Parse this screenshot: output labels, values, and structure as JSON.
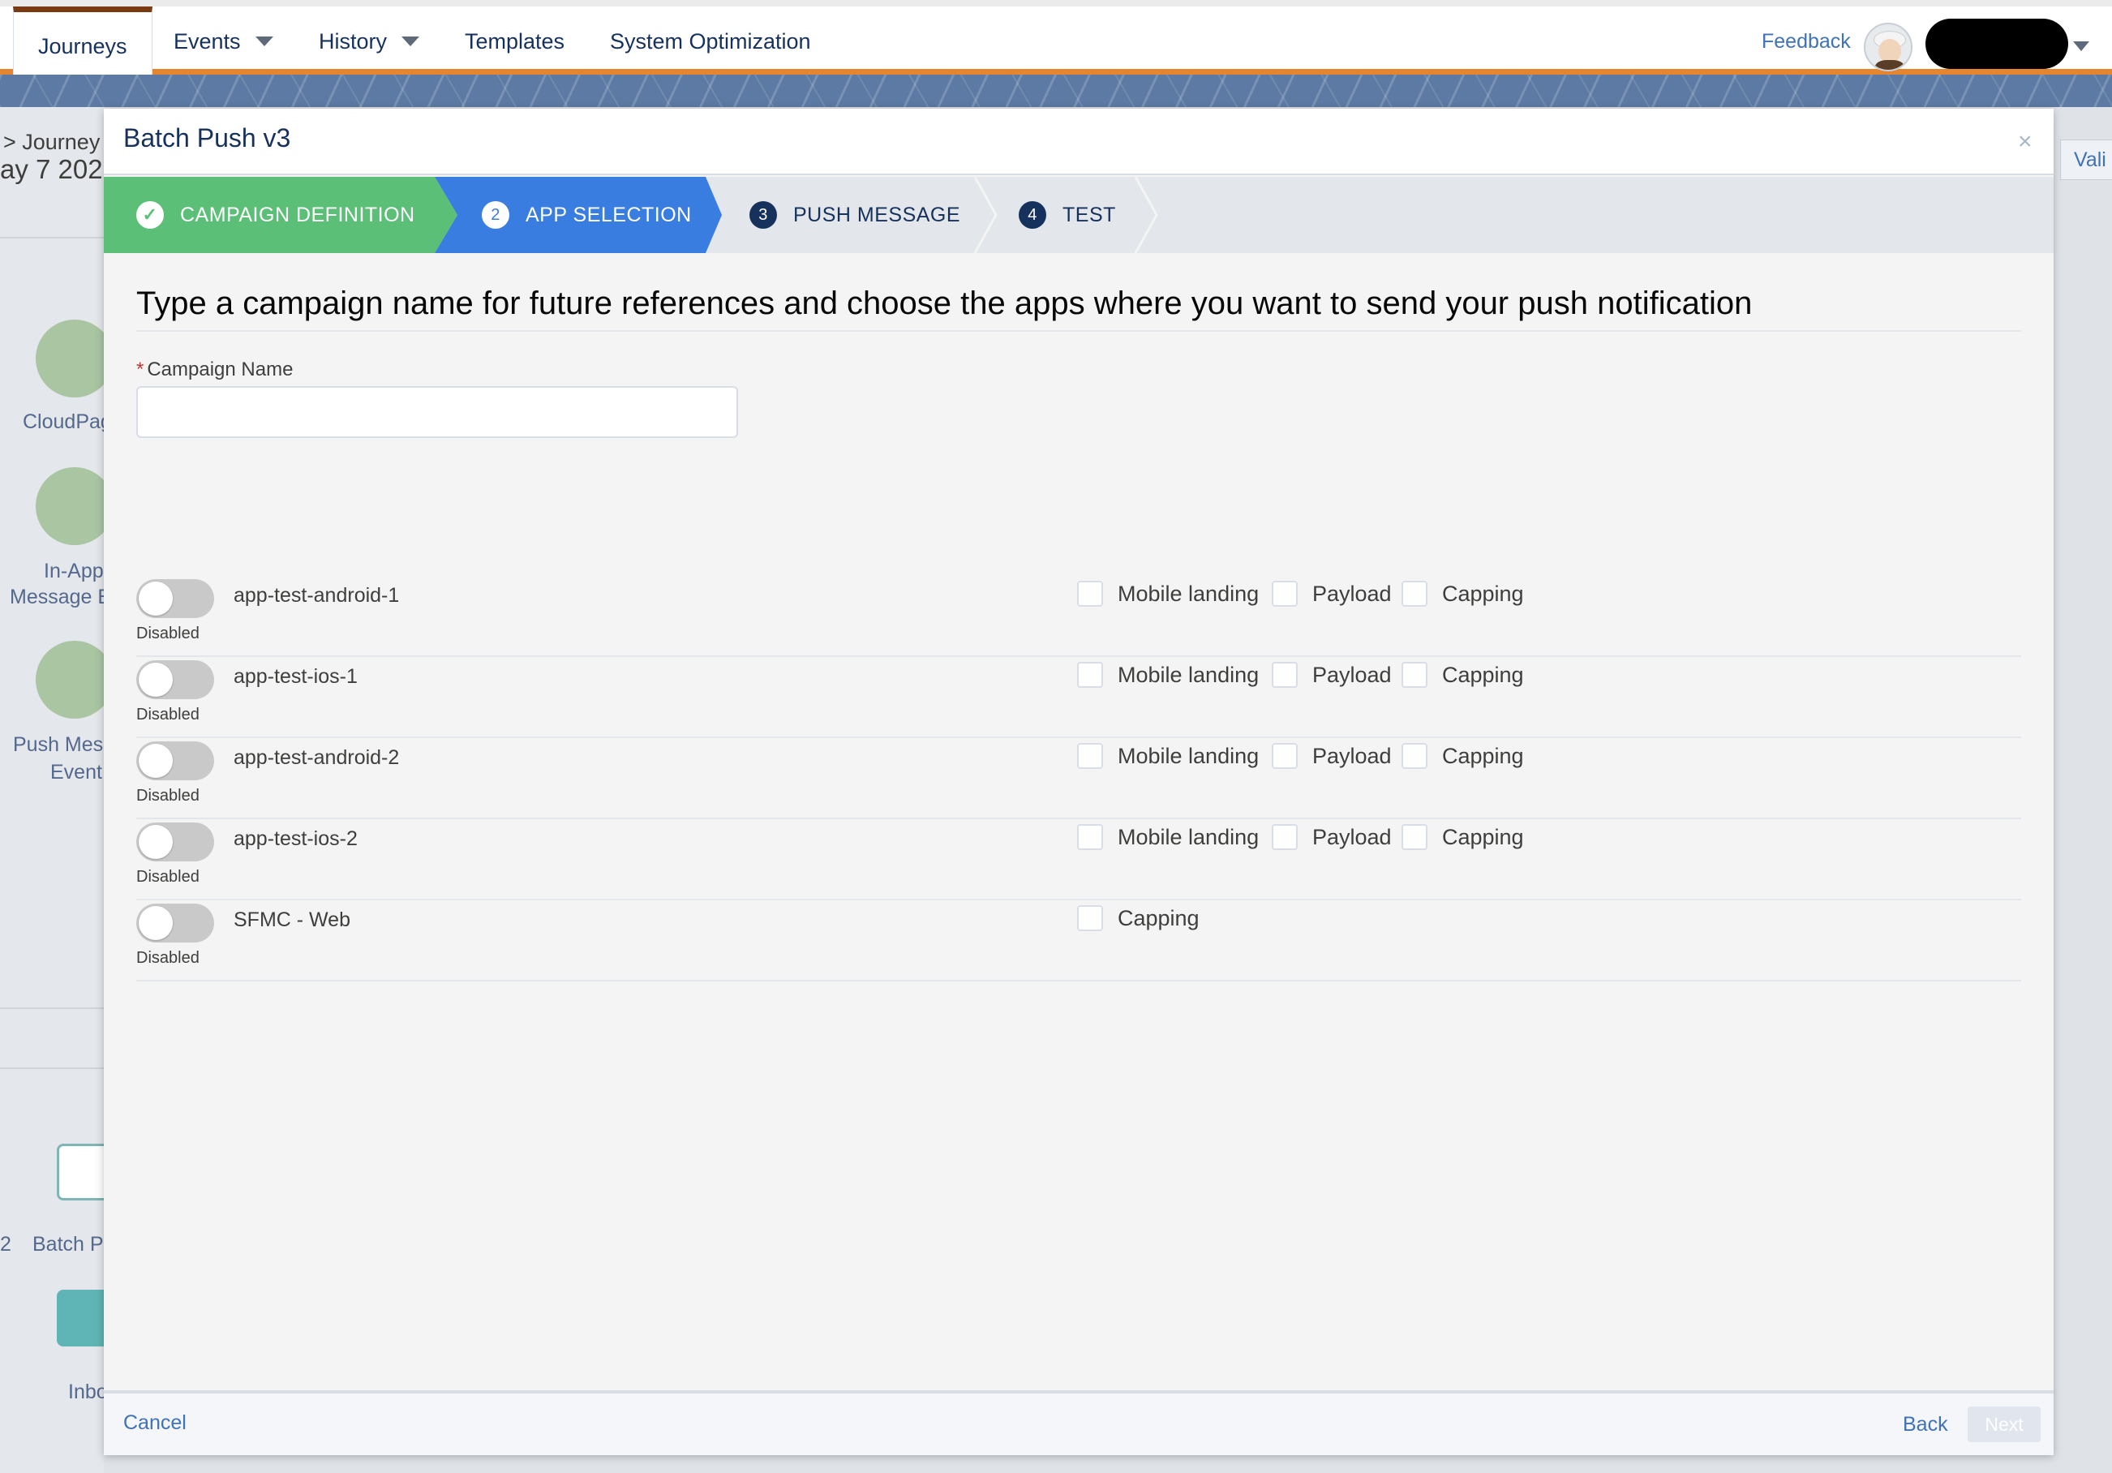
{
  "nav": {
    "tabs": [
      {
        "label": "Journeys",
        "dropdown": false,
        "active": true
      },
      {
        "label": "Events",
        "dropdown": true
      },
      {
        "label": "History",
        "dropdown": true
      },
      {
        "label": "Templates",
        "dropdown": false
      },
      {
        "label": "System Optimization",
        "dropdown": false
      }
    ],
    "feedback": "Feedback",
    "avatar_icon": "user-avatar-icon"
  },
  "background": {
    "breadcrumb": "> Journey",
    "date_fragment": "ay 7 202",
    "activities": [
      "CloudPag",
      "In-App",
      "Message E",
      "Push Mess",
      "Event",
      "2",
      "Batch Pu",
      "Inbo"
    ],
    "valid_button": "Vali"
  },
  "modal": {
    "title": "Batch Push v3",
    "close": "×",
    "steps": [
      {
        "number": "✓",
        "label": "CAMPAIGN DEFINITION",
        "state": "complete",
        "color": "#5cbf78"
      },
      {
        "number": "2",
        "label": "APP SELECTION",
        "state": "active",
        "color": "#3a7de0"
      },
      {
        "number": "3",
        "label": "PUSH MESSAGE",
        "state": "pending"
      },
      {
        "number": "4",
        "label": "TEST",
        "state": "pending"
      }
    ],
    "heading": "Type a campaign name for future references and choose the apps where you want to send your push notification",
    "campaign_field": {
      "label": "Campaign Name",
      "required_marker": "*",
      "value": "",
      "placeholder": ""
    },
    "apps": [
      {
        "name": "app-test-android-1",
        "toggle_state": "Disabled",
        "options": [
          "Mobile landing",
          "Payload",
          "Capping"
        ]
      },
      {
        "name": "app-test-ios-1",
        "toggle_state": "Disabled",
        "options": [
          "Mobile landing",
          "Payload",
          "Capping"
        ]
      },
      {
        "name": "app-test-android-2",
        "toggle_state": "Disabled",
        "options": [
          "Mobile landing",
          "Payload",
          "Capping"
        ]
      },
      {
        "name": "app-test-ios-2",
        "toggle_state": "Disabled",
        "options": [
          "Mobile landing",
          "Payload",
          "Capping"
        ]
      },
      {
        "name": "SFMC - Web",
        "toggle_state": "Disabled",
        "options": [
          "Capping"
        ]
      }
    ],
    "footer": {
      "cancel": "Cancel",
      "back": "Back",
      "next": "Next"
    }
  },
  "colors": {
    "nav_accent": "#e5862e",
    "complete": "#5cbf78",
    "active": "#3a7de0",
    "link": "#3f72b7"
  }
}
